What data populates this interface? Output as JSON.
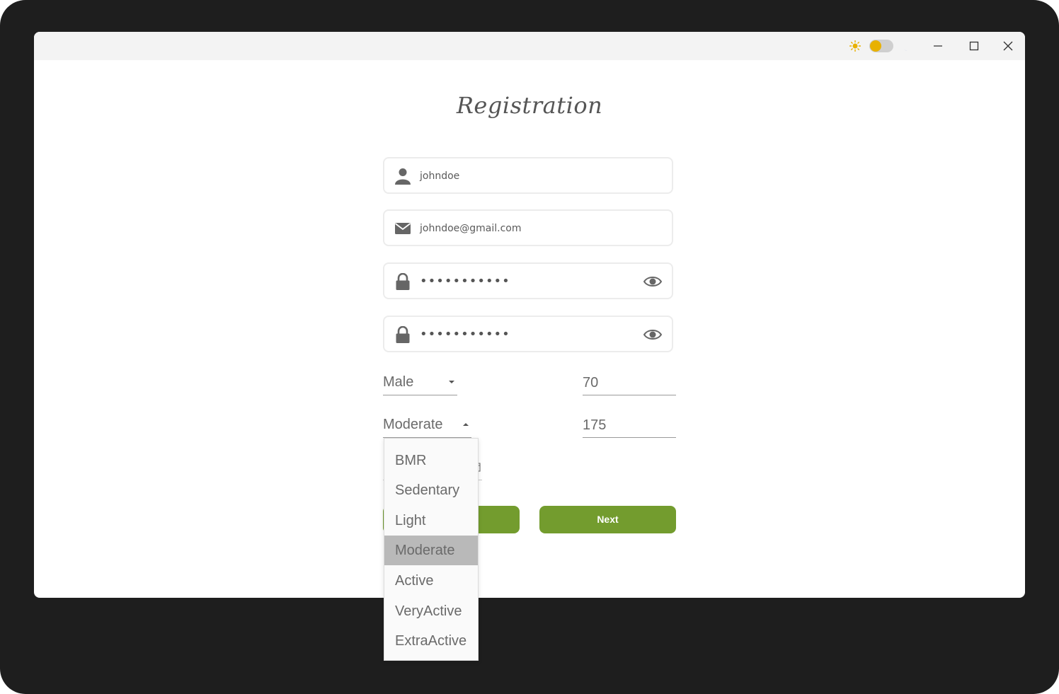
{
  "window": {
    "controls": {
      "minimize": "minimize",
      "maximize": "maximize",
      "close": "close"
    },
    "theme_toggle": {
      "light_icon": "sun-icon",
      "dark_icon": "moon-icon",
      "state": "light"
    }
  },
  "form": {
    "title": "Registration",
    "username": {
      "value": "johndoe",
      "icon": "user-icon"
    },
    "email": {
      "value": "johndoe@gmail.com",
      "icon": "mail-icon"
    },
    "password": {
      "value": "•••••••••••",
      "icon": "lock-icon",
      "toggle_icon": "eye-icon"
    },
    "confirm_password": {
      "value": "•••••••••••",
      "icon": "lock-icon",
      "toggle_icon": "eye-icon"
    },
    "gender": {
      "value": "Male"
    },
    "weight": {
      "value": "70"
    },
    "activity": {
      "value": "Moderate",
      "options": [
        "BMR",
        "Sedentary",
        "Light",
        "Moderate",
        "Active",
        "VeryActive",
        "ExtraActive"
      ],
      "selected_index": 3
    },
    "height": {
      "value": "175"
    },
    "buttons": {
      "next_label": "Next"
    }
  },
  "colors": {
    "accent": "#739c2e",
    "frame": "#1e1e1e",
    "titlebar": "#f3f3f3",
    "toggle_knob": "#e8b100",
    "moon": "#9fb4e0"
  }
}
